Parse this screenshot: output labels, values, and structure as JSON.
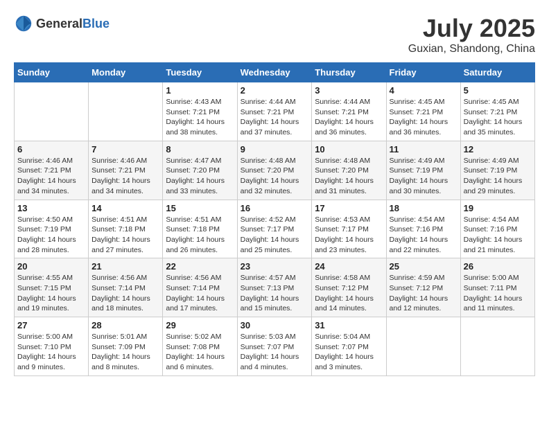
{
  "header": {
    "logo_general": "General",
    "logo_blue": "Blue",
    "title": "July 2025",
    "location": "Guxian, Shandong, China"
  },
  "days_of_week": [
    "Sunday",
    "Monday",
    "Tuesday",
    "Wednesday",
    "Thursday",
    "Friday",
    "Saturday"
  ],
  "weeks": [
    [
      {
        "day": "",
        "sunrise": "",
        "sunset": "",
        "daylight": ""
      },
      {
        "day": "",
        "sunrise": "",
        "sunset": "",
        "daylight": ""
      },
      {
        "day": "1",
        "sunrise": "Sunrise: 4:43 AM",
        "sunset": "Sunset: 7:21 PM",
        "daylight": "Daylight: 14 hours and 38 minutes."
      },
      {
        "day": "2",
        "sunrise": "Sunrise: 4:44 AM",
        "sunset": "Sunset: 7:21 PM",
        "daylight": "Daylight: 14 hours and 37 minutes."
      },
      {
        "day": "3",
        "sunrise": "Sunrise: 4:44 AM",
        "sunset": "Sunset: 7:21 PM",
        "daylight": "Daylight: 14 hours and 36 minutes."
      },
      {
        "day": "4",
        "sunrise": "Sunrise: 4:45 AM",
        "sunset": "Sunset: 7:21 PM",
        "daylight": "Daylight: 14 hours and 36 minutes."
      },
      {
        "day": "5",
        "sunrise": "Sunrise: 4:45 AM",
        "sunset": "Sunset: 7:21 PM",
        "daylight": "Daylight: 14 hours and 35 minutes."
      }
    ],
    [
      {
        "day": "6",
        "sunrise": "Sunrise: 4:46 AM",
        "sunset": "Sunset: 7:21 PM",
        "daylight": "Daylight: 14 hours and 34 minutes."
      },
      {
        "day": "7",
        "sunrise": "Sunrise: 4:46 AM",
        "sunset": "Sunset: 7:21 PM",
        "daylight": "Daylight: 14 hours and 34 minutes."
      },
      {
        "day": "8",
        "sunrise": "Sunrise: 4:47 AM",
        "sunset": "Sunset: 7:20 PM",
        "daylight": "Daylight: 14 hours and 33 minutes."
      },
      {
        "day": "9",
        "sunrise": "Sunrise: 4:48 AM",
        "sunset": "Sunset: 7:20 PM",
        "daylight": "Daylight: 14 hours and 32 minutes."
      },
      {
        "day": "10",
        "sunrise": "Sunrise: 4:48 AM",
        "sunset": "Sunset: 7:20 PM",
        "daylight": "Daylight: 14 hours and 31 minutes."
      },
      {
        "day": "11",
        "sunrise": "Sunrise: 4:49 AM",
        "sunset": "Sunset: 7:19 PM",
        "daylight": "Daylight: 14 hours and 30 minutes."
      },
      {
        "day": "12",
        "sunrise": "Sunrise: 4:49 AM",
        "sunset": "Sunset: 7:19 PM",
        "daylight": "Daylight: 14 hours and 29 minutes."
      }
    ],
    [
      {
        "day": "13",
        "sunrise": "Sunrise: 4:50 AM",
        "sunset": "Sunset: 7:19 PM",
        "daylight": "Daylight: 14 hours and 28 minutes."
      },
      {
        "day": "14",
        "sunrise": "Sunrise: 4:51 AM",
        "sunset": "Sunset: 7:18 PM",
        "daylight": "Daylight: 14 hours and 27 minutes."
      },
      {
        "day": "15",
        "sunrise": "Sunrise: 4:51 AM",
        "sunset": "Sunset: 7:18 PM",
        "daylight": "Daylight: 14 hours and 26 minutes."
      },
      {
        "day": "16",
        "sunrise": "Sunrise: 4:52 AM",
        "sunset": "Sunset: 7:17 PM",
        "daylight": "Daylight: 14 hours and 25 minutes."
      },
      {
        "day": "17",
        "sunrise": "Sunrise: 4:53 AM",
        "sunset": "Sunset: 7:17 PM",
        "daylight": "Daylight: 14 hours and 23 minutes."
      },
      {
        "day": "18",
        "sunrise": "Sunrise: 4:54 AM",
        "sunset": "Sunset: 7:16 PM",
        "daylight": "Daylight: 14 hours and 22 minutes."
      },
      {
        "day": "19",
        "sunrise": "Sunrise: 4:54 AM",
        "sunset": "Sunset: 7:16 PM",
        "daylight": "Daylight: 14 hours and 21 minutes."
      }
    ],
    [
      {
        "day": "20",
        "sunrise": "Sunrise: 4:55 AM",
        "sunset": "Sunset: 7:15 PM",
        "daylight": "Daylight: 14 hours and 19 minutes."
      },
      {
        "day": "21",
        "sunrise": "Sunrise: 4:56 AM",
        "sunset": "Sunset: 7:14 PM",
        "daylight": "Daylight: 14 hours and 18 minutes."
      },
      {
        "day": "22",
        "sunrise": "Sunrise: 4:56 AM",
        "sunset": "Sunset: 7:14 PM",
        "daylight": "Daylight: 14 hours and 17 minutes."
      },
      {
        "day": "23",
        "sunrise": "Sunrise: 4:57 AM",
        "sunset": "Sunset: 7:13 PM",
        "daylight": "Daylight: 14 hours and 15 minutes."
      },
      {
        "day": "24",
        "sunrise": "Sunrise: 4:58 AM",
        "sunset": "Sunset: 7:12 PM",
        "daylight": "Daylight: 14 hours and 14 minutes."
      },
      {
        "day": "25",
        "sunrise": "Sunrise: 4:59 AM",
        "sunset": "Sunset: 7:12 PM",
        "daylight": "Daylight: 14 hours and 12 minutes."
      },
      {
        "day": "26",
        "sunrise": "Sunrise: 5:00 AM",
        "sunset": "Sunset: 7:11 PM",
        "daylight": "Daylight: 14 hours and 11 minutes."
      }
    ],
    [
      {
        "day": "27",
        "sunrise": "Sunrise: 5:00 AM",
        "sunset": "Sunset: 7:10 PM",
        "daylight": "Daylight: 14 hours and 9 minutes."
      },
      {
        "day": "28",
        "sunrise": "Sunrise: 5:01 AM",
        "sunset": "Sunset: 7:09 PM",
        "daylight": "Daylight: 14 hours and 8 minutes."
      },
      {
        "day": "29",
        "sunrise": "Sunrise: 5:02 AM",
        "sunset": "Sunset: 7:08 PM",
        "daylight": "Daylight: 14 hours and 6 minutes."
      },
      {
        "day": "30",
        "sunrise": "Sunrise: 5:03 AM",
        "sunset": "Sunset: 7:07 PM",
        "daylight": "Daylight: 14 hours and 4 minutes."
      },
      {
        "day": "31",
        "sunrise": "Sunrise: 5:04 AM",
        "sunset": "Sunset: 7:07 PM",
        "daylight": "Daylight: 14 hours and 3 minutes."
      },
      {
        "day": "",
        "sunrise": "",
        "sunset": "",
        "daylight": ""
      },
      {
        "day": "",
        "sunrise": "",
        "sunset": "",
        "daylight": ""
      }
    ]
  ]
}
